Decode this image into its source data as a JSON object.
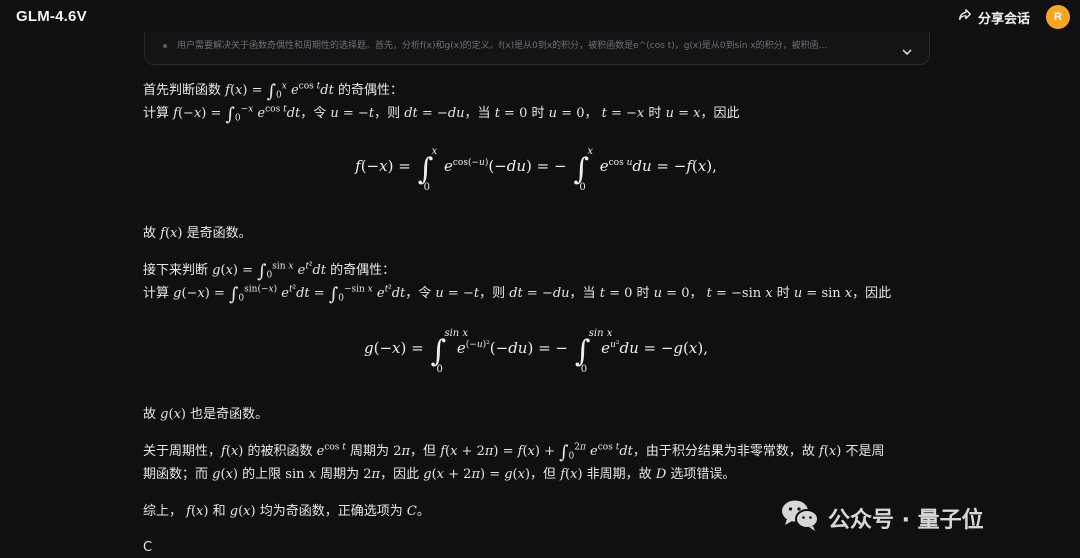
{
  "header": {
    "app_title": "GLM-4.6V",
    "share_label": "分享会话",
    "avatar_initial": "R"
  },
  "thinking": {
    "summary": "用户需要解决关于函数奇偶性和周期性的选择题。首先，分析f(x)和g(x)的定义。f(x)是从0到x的积分，被积函数是e^(cos t)，g(x)是从0到sin x的积分，被积函..."
  },
  "answer": {
    "p1_a": "首先判断函数",
    "p1_b": "的奇偶性：",
    "p2_a": "计算",
    "p2_b": "，令",
    "p2_c": "，则",
    "p2_d": "，当",
    "p2_e": "时",
    "p2_f": "，",
    "p2_g": "时",
    "p2_h": "，因此",
    "p3_a": "故",
    "p3_b": "是奇函数。",
    "p4_a": "接下来判断",
    "p4_b": "的奇偶性：",
    "p5_a": "计算",
    "p5_b": "，令",
    "p5_c": "，则",
    "p5_d": "，当",
    "p5_e": "时",
    "p5_f": "，",
    "p5_g": "时",
    "p5_h": "，因此",
    "p6_a": "故",
    "p6_b": "也是奇函数。",
    "p7_a": "关于周期性，",
    "p7_b": "的被积函数",
    "p7_c": "周期为",
    "p7_d": "，但",
    "p7_e": "，由于积分结果为非零常数，故",
    "p7_f": "不是周",
    "p8_a": "期函数；而",
    "p8_b": "的上限",
    "p8_c": "周期为",
    "p8_d": "，因此",
    "p8_e": "，但",
    "p8_f": "非周期，故",
    "p8_g": "选项错误。",
    "p9_a": "综上，",
    "p9_b": "和",
    "p9_c": "均为奇函数，正确选项为",
    "p9_d": "。",
    "final": "C"
  },
  "watermark": {
    "text": "公众号 · 量子位"
  },
  "colors": {
    "background": "#101012",
    "avatar": "#f5a623",
    "text": "#e6e6e8",
    "muted": "#6f6f77"
  }
}
